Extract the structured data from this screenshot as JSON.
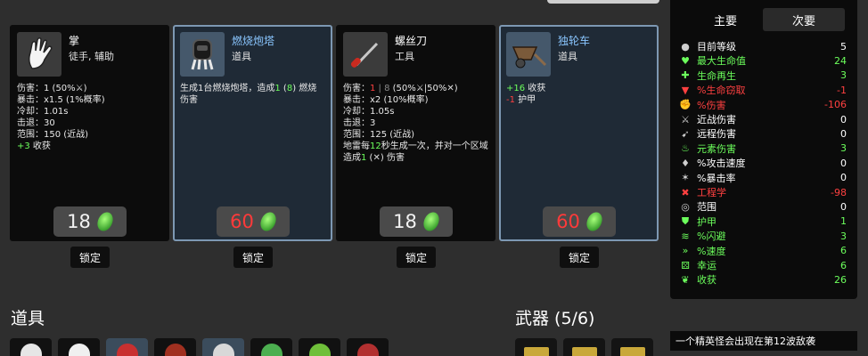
{
  "cards": [
    {
      "name": "掌",
      "type": "徒手, 辅助",
      "price": "18",
      "expensive": false,
      "lock": "锁定",
      "icon": "palm-hand-icon",
      "lines": [
        [
          {
            "t": "伤害：1 (50%"
          },
          {
            "t": "⚔",
            "c": "icon"
          },
          {
            "t": ")"
          }
        ],
        [
          {
            "t": "暴击：x1.5 (1%概率)"
          }
        ],
        [
          {
            "t": "冷却：1.01s"
          }
        ],
        [
          {
            "t": "击退：30"
          }
        ],
        [
          {
            "t": "范围：150 (近战)"
          }
        ],
        [
          {
            "t": "+3",
            "c": "g"
          },
          {
            "t": " 收获"
          }
        ]
      ]
    },
    {
      "name": "燃烧炮塔",
      "type": "道具",
      "price": "60",
      "expensive": true,
      "lock": "锁定",
      "icon": "turret-icon",
      "lines": [
        [
          {
            "t": "生成1台燃烧炮塔，造成"
          },
          {
            "t": "1",
            "c": "g"
          },
          {
            "t": " ("
          },
          {
            "t": "8",
            "c": "g"
          },
          {
            "t": ") 燃烧"
          }
        ],
        [
          {
            "t": "伤害"
          }
        ]
      ]
    },
    {
      "name": "螺丝刀",
      "type": "工具",
      "price": "18",
      "expensive": false,
      "lock": "锁定",
      "icon": "screwdriver-icon",
      "lines": [
        [
          {
            "t": "伤害："
          },
          {
            "t": "1",
            "c": "r"
          },
          {
            "t": " | 8 ",
            "c": "gy"
          },
          {
            "t": "(50%"
          },
          {
            "t": "⚔",
            "c": "icon"
          },
          {
            "t": "|50%"
          },
          {
            "t": "✕",
            "c": "icon"
          },
          {
            "t": ")"
          }
        ],
        [
          {
            "t": "暴击：x2 (10%概率)"
          }
        ],
        [
          {
            "t": "冷却：1.05s"
          }
        ],
        [
          {
            "t": "击退：3"
          }
        ],
        [
          {
            "t": "范围：125 (近战)"
          }
        ],
        [
          {
            "t": "地雷每"
          },
          {
            "t": "12",
            "c": "g"
          },
          {
            "t": "秒生成一次，并对一个区域"
          }
        ],
        [
          {
            "t": "造成"
          },
          {
            "t": "1",
            "c": "g"
          },
          {
            "t": " ("
          },
          {
            "t": "✕",
            "c": "icon"
          },
          {
            "t": ") 伤害"
          }
        ]
      ]
    },
    {
      "name": "独轮车",
      "type": "道具",
      "price": "60",
      "expensive": true,
      "lock": "锁定",
      "icon": "wheelbarrow-icon",
      "lines": [
        [
          {
            "t": "+16",
            "c": "g"
          },
          {
            "t": " 收获"
          }
        ],
        [
          {
            "t": "-1",
            "c": "r"
          },
          {
            "t": " 护甲"
          }
        ]
      ]
    }
  ],
  "sections": {
    "items": "道具",
    "weapons": "武器 (5/6)"
  },
  "panel": {
    "tabs": [
      "主要",
      "次要"
    ],
    "stats": [
      {
        "icon": "level-icon",
        "label": "目前等级",
        "value": "5",
        "color": "#ffffff",
        "sym": "●"
      },
      {
        "icon": "heart-icon",
        "label": "最大生命值",
        "value": "24",
        "color": "#6cff5c",
        "sym": "♥"
      },
      {
        "icon": "regen-icon",
        "label": "生命再生",
        "value": "3",
        "color": "#6cff5c",
        "sym": "✚"
      },
      {
        "icon": "lifesteal-icon",
        "label": "%生命窃取",
        "value": "-1",
        "color": "#ff4040",
        "sym": "▼"
      },
      {
        "icon": "damage-icon",
        "label": "%伤害",
        "value": "-106",
        "color": "#ff4040",
        "sym": "✊"
      },
      {
        "icon": "melee-icon",
        "label": "近战伤害",
        "value": "0",
        "color": "#ffffff",
        "sym": "⚔"
      },
      {
        "icon": "ranged-icon",
        "label": "远程伤害",
        "value": "0",
        "color": "#ffffff",
        "sym": "➹"
      },
      {
        "icon": "elemental-icon",
        "label": "元素伤害",
        "value": "3",
        "color": "#6cff5c",
        "sym": "♨"
      },
      {
        "icon": "attack-speed-icon",
        "label": "%攻击速度",
        "value": "0",
        "color": "#ffffff",
        "sym": "♦"
      },
      {
        "icon": "crit-icon",
        "label": "%暴击率",
        "value": "0",
        "color": "#ffffff",
        "sym": "✶"
      },
      {
        "icon": "engineering-icon",
        "label": "工程学",
        "value": "-98",
        "color": "#ff4040",
        "sym": "✖"
      },
      {
        "icon": "range-icon",
        "label": "范围",
        "value": "0",
        "color": "#ffffff",
        "sym": "◎"
      },
      {
        "icon": "armor-icon",
        "label": "护甲",
        "value": "1",
        "color": "#6cff5c",
        "sym": "⛊"
      },
      {
        "icon": "dodge-icon",
        "label": "%闪避",
        "value": "3",
        "color": "#6cff5c",
        "sym": "≋"
      },
      {
        "icon": "speed-icon",
        "label": "%速度",
        "value": "6",
        "color": "#6cff5c",
        "sym": "»"
      },
      {
        "icon": "luck-icon",
        "label": "幸运",
        "value": "6",
        "color": "#6cff5c",
        "sym": "⚄"
      },
      {
        "icon": "harvesting-icon",
        "label": "收获",
        "value": "26",
        "color": "#6cff5c",
        "sym": "❦"
      }
    ]
  },
  "notice": "一个精英怪会出现在第12波敌袭",
  "inventory_slots": [
    {
      "icon": "item-slot-icon-1",
      "style": "dark"
    },
    {
      "icon": "egg-icon",
      "style": "dark"
    },
    {
      "icon": "creature-icon",
      "style": "blue"
    },
    {
      "icon": "item-slot-icon-4",
      "style": "dark"
    },
    {
      "icon": "rabbit-icon",
      "style": "blue"
    },
    {
      "icon": "bush-icon",
      "style": "dark"
    },
    {
      "icon": "leaf-icon",
      "style": "dark"
    },
    {
      "icon": "berry-icon",
      "style": "dark"
    }
  ],
  "weapon_slots": [
    {
      "icon": "weapon-slot-icon-1"
    },
    {
      "icon": "weapon-slot-icon-2"
    },
    {
      "icon": "weapon-slot-icon-3"
    }
  ]
}
